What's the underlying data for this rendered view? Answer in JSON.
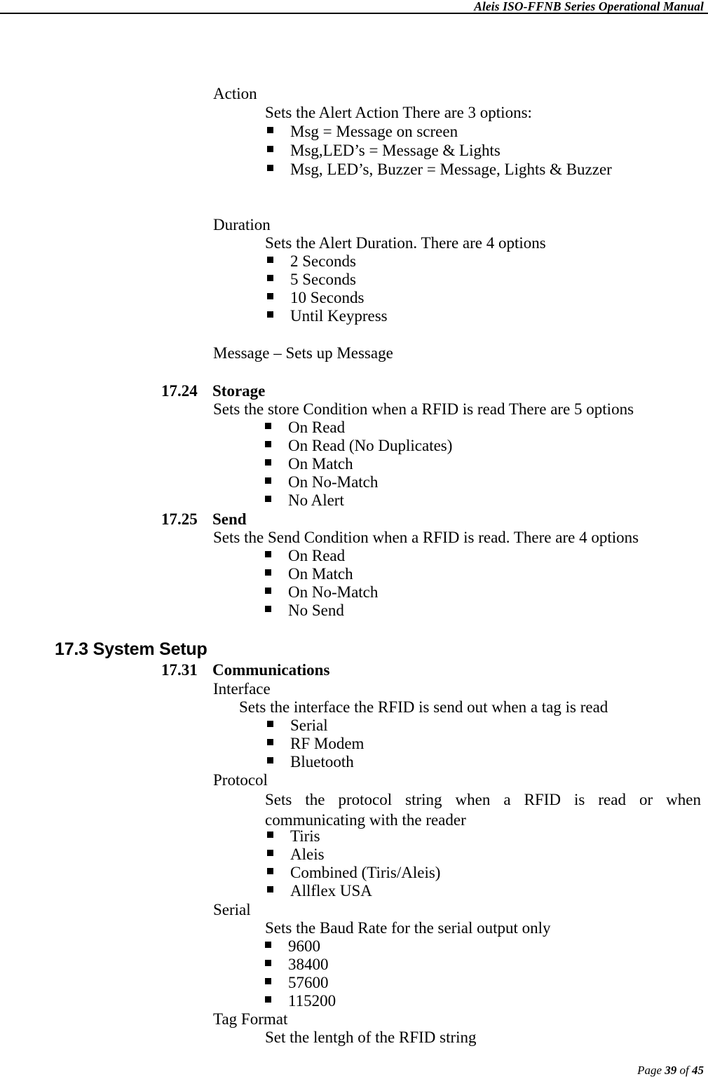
{
  "header": {
    "title": "Aleis ISO-FFNB Series Operational Manual"
  },
  "footer": {
    "page_word": "Page",
    "page_number": "39",
    "of_word": "of",
    "total_pages": "45"
  },
  "body": {
    "action": {
      "label": "Action",
      "description": "Sets the Alert Action There are 3 options:",
      "options": [
        "Msg = Message on screen",
        "Msg,LED’s = Message & Lights",
        "Msg, LED’s, Buzzer = Message, Lights & Buzzer"
      ]
    },
    "duration": {
      "label": "Duration",
      "description": "Sets the Alert Duration. There are 4 options",
      "options": [
        "2 Seconds",
        "5 Seconds",
        "10 Seconds",
        "Until Keypress"
      ]
    },
    "message": {
      "line": "Message – Sets up Message"
    },
    "storage": {
      "number": "17.24",
      "title": "Storage",
      "description": "Sets the store Condition when a RFID is read There are 5 options",
      "options": [
        "On Read",
        "On Read (No Duplicates)",
        "On Match",
        "On No-Match",
        "No Alert"
      ]
    },
    "send": {
      "number": "17.25",
      "title": "Send",
      "description": "Sets the Send Condition when a RFID is read. There are 4 options",
      "options": [
        "On Read",
        "On Match",
        "On No-Match",
        "No Send"
      ]
    },
    "system_setup": {
      "heading": "17.3 System Setup",
      "communications": {
        "number": "17.31",
        "title": "Communications",
        "interface": {
          "label": "Interface",
          "description": "Sets the interface the RFID is send out when a tag is read",
          "options": [
            "Serial",
            "RF Modem",
            "Bluetooth"
          ]
        },
        "protocol": {
          "label": "Protocol",
          "description": "Sets the protocol string when a RFID is read or when communicating with the reader",
          "options": [
            "Tiris",
            "Aleis",
            "Combined (Tiris/Aleis)",
            "Allflex USA"
          ]
        },
        "serial": {
          "label": "Serial",
          "description": "Sets the Baud Rate for the serial output only",
          "options": [
            "9600",
            "38400",
            "57600",
            "115200"
          ]
        },
        "tag_format": {
          "label": "Tag Format",
          "description": "Set the lentgh of the RFID string"
        }
      }
    }
  }
}
